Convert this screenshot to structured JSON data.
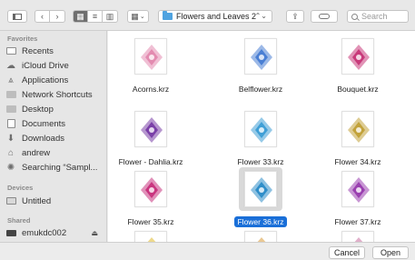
{
  "toolbar": {
    "path_label": "Flowers and Leaves 2",
    "search_placeholder": "Search"
  },
  "sidebar": {
    "sections": [
      {
        "title": "Favorites",
        "items": [
          {
            "label": "Recents",
            "icon": "recents-icon"
          },
          {
            "label": "iCloud Drive",
            "icon": "cloud-icon"
          },
          {
            "label": "Applications",
            "icon": "applications-icon"
          },
          {
            "label": "Network Shortcuts",
            "icon": "folder-icon"
          },
          {
            "label": "Desktop",
            "icon": "desktop-icon"
          },
          {
            "label": "Documents",
            "icon": "documents-icon"
          },
          {
            "label": "Downloads",
            "icon": "downloads-icon"
          },
          {
            "label": "andrew",
            "icon": "home-icon"
          },
          {
            "label": "Searching “Sampl...",
            "icon": "smart-folder-icon"
          }
        ]
      },
      {
        "title": "Devices",
        "items": [
          {
            "label": "Untitled",
            "icon": "disk-icon"
          }
        ]
      },
      {
        "title": "Shared",
        "items": [
          {
            "label": "emukdc002",
            "icon": "server-icon"
          }
        ]
      }
    ]
  },
  "files": [
    {
      "name": "Acorns.krz",
      "color": "#e38bb0"
    },
    {
      "name": "Belflower.krz",
      "color": "#4a7fd4"
    },
    {
      "name": "Bouquet.krz",
      "color": "#c83a7a"
    },
    {
      "name": "Flower - Dahlia.krz",
      "color": "#7a3fa8"
    },
    {
      "name": "Flower 33.krz",
      "color": "#3f9fd6"
    },
    {
      "name": "Flower 34.krz",
      "color": "#c2a23a"
    },
    {
      "name": "Flower 35.krz",
      "color": "#c9357f"
    },
    {
      "name": "Flower 36.krz",
      "color": "#2f8ec9",
      "selected": true
    },
    {
      "name": "Flower 37.krz",
      "color": "#9a3fb0"
    },
    {
      "name": "",
      "color": "#e0b92c"
    },
    {
      "name": "",
      "color": "#d99a3a"
    },
    {
      "name": "",
      "color": "#c86fa0"
    }
  ],
  "buttons": {
    "cancel": "Cancel",
    "open": "Open"
  }
}
